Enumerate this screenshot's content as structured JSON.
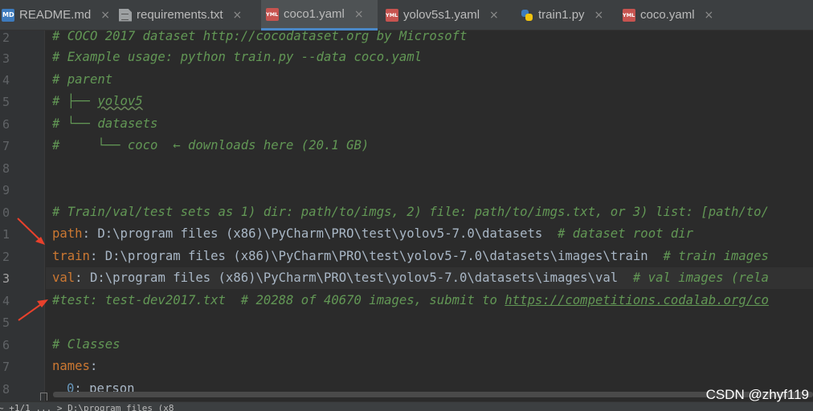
{
  "tabs": [
    {
      "label": "README.md",
      "icon": "markdown-file-icon",
      "active": false
    },
    {
      "label": "requirements.txt",
      "icon": "text-file-icon",
      "active": false
    },
    {
      "label": "coco1.yaml",
      "icon": "yaml-file-icon",
      "active": true
    },
    {
      "label": "yolov5s1.yaml",
      "icon": "yaml-file-icon",
      "active": false
    },
    {
      "label": "train1.py",
      "icon": "python-file-icon",
      "active": false
    },
    {
      "label": "coco.yaml",
      "icon": "yaml-file-icon",
      "active": false
    }
  ],
  "close_glyph": "×",
  "line_numbers": [
    "2",
    "3",
    "4",
    "5",
    "6",
    "7",
    "8",
    "9",
    "0",
    "1",
    "2",
    "3",
    "4",
    "5",
    "6",
    "7",
    "8"
  ],
  "code": {
    "l2": "# COCO 2017 dataset http://cocodataset.org by Microsoft",
    "l3": "# Example usage: python train.py --data coco.yaml",
    "l4": "# parent",
    "l5_prefix": "# ├── ",
    "l5_link": "yolov5",
    "l6": "# └── datasets",
    "l7": "#     └── coco  ← downloads here (20.1 GB)",
    "l10": "# Train/val/test sets as 1) dir: path/to/imgs, 2) file: path/to/imgs.txt, or 3) list: [path/to/",
    "l11_key": "path",
    "l11_val": ": D:\\program files (x86)\\PyCharm\\PRO\\test\\yolov5-7.0\\datasets  ",
    "l11_cmt": "# dataset root dir",
    "l12_key": "train",
    "l12_val": ": D:\\program files (x86)\\PyCharm\\PRO\\test\\yolov5-7.0\\datasets\\images\\train  ",
    "l12_cmt": "# train images",
    "l13_key": "val",
    "l13_val": ": D:\\program files (x86)\\PyCharm\\PRO\\test\\yolov5-7.0\\datasets\\images\\val  ",
    "l13_cmt": "# val images (rela",
    "l14_cmt": "#test: test-dev2017.txt  # 20288 of 40670 images, submit to ",
    "l14_link": "https://competitions.codalab.org/co",
    "l16": "# Classes",
    "l17_key": "names",
    "l17_colon": ":",
    "l18_num": "0",
    "l18_rest": ": person"
  },
  "status_text": "~ +1/1 ... > D:\\program files (x8",
  "watermark": "CSDN @zhyf119",
  "colors": {
    "comment": "#629755",
    "key": "#cc7832",
    "arrow": "#e8412c",
    "active_tab_underline": "#4a88c7"
  }
}
